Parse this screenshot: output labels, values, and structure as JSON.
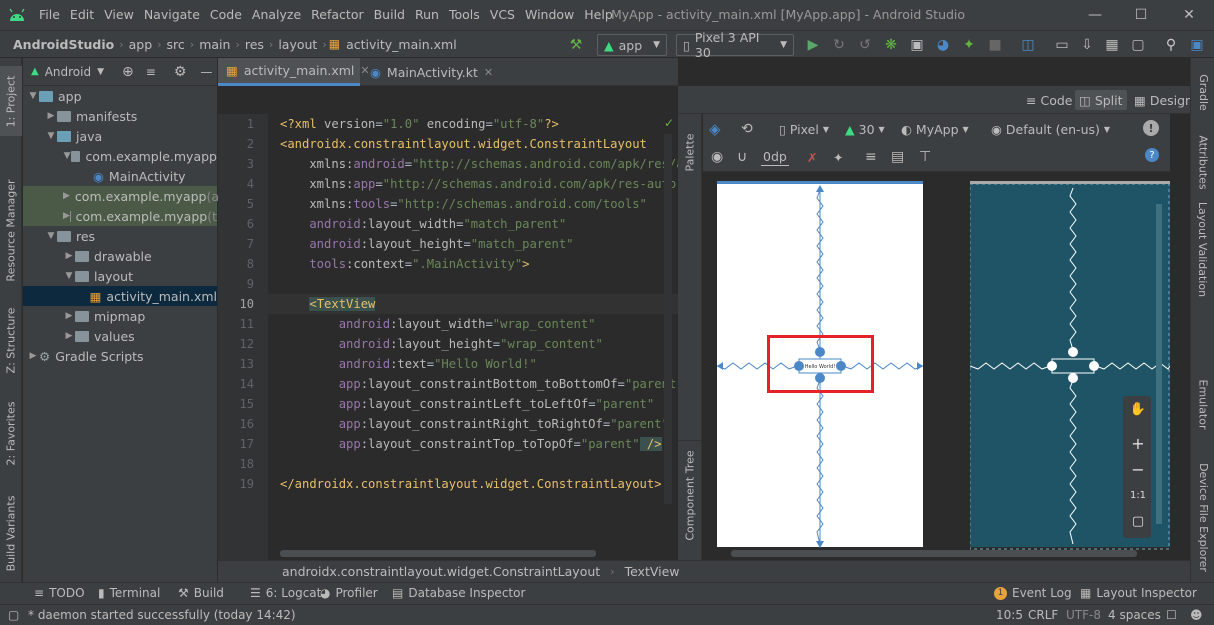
{
  "menubar": {
    "items": [
      "File",
      "Edit",
      "View",
      "Navigate",
      "Code",
      "Analyze",
      "Refactor",
      "Build",
      "Run",
      "Tools",
      "VCS",
      "Window",
      "Help"
    ],
    "window_title": "MyApp - activity_main.xml [MyApp.app] - Android Studio"
  },
  "navbar": {
    "breadcrumbs": [
      "AndroidStudio",
      "app",
      "src",
      "main",
      "res",
      "layout",
      "activity_main.xml"
    ],
    "run_config": "app",
    "device": "Pixel 3 API 30"
  },
  "project_panel": {
    "view_label": "Android",
    "tree": [
      {
        "label": "app",
        "kind": "root"
      },
      {
        "label": "manifests",
        "kind": "folder"
      },
      {
        "label": "java",
        "kind": "folder"
      },
      {
        "label": "com.example.myapp",
        "kind": "package"
      },
      {
        "label": "MainActivity",
        "kind": "class"
      },
      {
        "label": "com.example.myapp",
        "suffix": "(a",
        "kind": "package"
      },
      {
        "label": "com.example.myapp",
        "suffix": "(t",
        "kind": "package"
      },
      {
        "label": "res",
        "kind": "folder"
      },
      {
        "label": "drawable",
        "kind": "folder"
      },
      {
        "label": "layout",
        "kind": "folder"
      },
      {
        "label": "activity_main.xml",
        "kind": "file"
      },
      {
        "label": "mipmap",
        "kind": "folder"
      },
      {
        "label": "values",
        "kind": "folder"
      },
      {
        "label": "Gradle Scripts",
        "kind": "gradle"
      }
    ]
  },
  "side_tabs": {
    "left": [
      "1: Project",
      "Resource Manager",
      "Z: Structure",
      "2: Favorites",
      "Build Variants"
    ],
    "right": [
      "Gradle",
      "Attributes",
      "Layout Validation",
      "Emulator",
      "Device File Explorer"
    ]
  },
  "editor_tabs": [
    {
      "label": "activity_main.xml",
      "active": true
    },
    {
      "label": "MainActivity.kt",
      "active": false
    }
  ],
  "view_modes": [
    "Code",
    "Split",
    "Design"
  ],
  "editor": {
    "line_numbers": [
      "1",
      "2",
      "3",
      "4",
      "5",
      "6",
      "7",
      "8",
      "9",
      "10",
      "11",
      "12",
      "13",
      "14",
      "15",
      "16",
      "17",
      "18",
      "19"
    ],
    "lines": [
      [
        {
          "t": "<?xml ",
          "c": "pi"
        },
        {
          "t": "version",
          "c": "attr"
        },
        {
          "t": "=",
          "c": "p"
        },
        {
          "t": "\"1.0\"",
          "c": "val"
        },
        {
          "t": " encoding",
          "c": "attr"
        },
        {
          "t": "=",
          "c": "p"
        },
        {
          "t": "\"utf-8\"",
          "c": "val"
        },
        {
          "t": "?>",
          "c": "pi"
        }
      ],
      [
        {
          "t": "<androidx.constraintlayout.widget.ConstraintLayout",
          "c": "tag"
        }
      ],
      [
        {
          "t": "    xmlns:",
          "c": "attr"
        },
        {
          "t": "android",
          "c": "ns"
        },
        {
          "t": "=",
          "c": "p"
        },
        {
          "t": "\"http://schemas.android.com/apk/res/and",
          "c": "val"
        }
      ],
      [
        {
          "t": "    xmlns:",
          "c": "attr"
        },
        {
          "t": "app",
          "c": "ns"
        },
        {
          "t": "=",
          "c": "p"
        },
        {
          "t": "\"http://schemas.android.com/apk/res-auto\"",
          "c": "val"
        }
      ],
      [
        {
          "t": "    xmlns:",
          "c": "attr"
        },
        {
          "t": "tools",
          "c": "ns"
        },
        {
          "t": "=",
          "c": "p"
        },
        {
          "t": "\"http://schemas.android.com/tools\"",
          "c": "val"
        }
      ],
      [
        {
          "t": "    android",
          "c": "ns"
        },
        {
          "t": ":layout_width",
          "c": "attr"
        },
        {
          "t": "=",
          "c": "p"
        },
        {
          "t": "\"match_parent\"",
          "c": "val"
        }
      ],
      [
        {
          "t": "    android",
          "c": "ns"
        },
        {
          "t": ":layout_height",
          "c": "attr"
        },
        {
          "t": "=",
          "c": "p"
        },
        {
          "t": "\"match_parent\"",
          "c": "val"
        }
      ],
      [
        {
          "t": "    tools",
          "c": "ns"
        },
        {
          "t": ":context",
          "c": "attr"
        },
        {
          "t": "=",
          "c": "p"
        },
        {
          "t": "\".MainActivity\"",
          "c": "val"
        },
        {
          "t": ">",
          "c": "tag"
        }
      ],
      [],
      [
        {
          "t": "    ",
          "c": "p"
        },
        {
          "t": "<TextView",
          "c": "tagh"
        }
      ],
      [
        {
          "t": "        android",
          "c": "ns"
        },
        {
          "t": ":layout_width",
          "c": "attr"
        },
        {
          "t": "=",
          "c": "p"
        },
        {
          "t": "\"wrap_content\"",
          "c": "val"
        }
      ],
      [
        {
          "t": "        android",
          "c": "ns"
        },
        {
          "t": ":layout_height",
          "c": "attr"
        },
        {
          "t": "=",
          "c": "p"
        },
        {
          "t": "\"wrap_content\"",
          "c": "val"
        }
      ],
      [
        {
          "t": "        android",
          "c": "ns"
        },
        {
          "t": ":text",
          "c": "attr"
        },
        {
          "t": "=",
          "c": "p"
        },
        {
          "t": "\"Hello World!\"",
          "c": "val"
        }
      ],
      [
        {
          "t": "        app",
          "c": "ns"
        },
        {
          "t": ":layout_constraintBottom_toBottomOf",
          "c": "attr"
        },
        {
          "t": "=",
          "c": "p"
        },
        {
          "t": "\"parent\"",
          "c": "val"
        }
      ],
      [
        {
          "t": "        app",
          "c": "ns"
        },
        {
          "t": ":layout_constraintLeft_toLeftOf",
          "c": "attr"
        },
        {
          "t": "=",
          "c": "p"
        },
        {
          "t": "\"parent\"",
          "c": "val"
        }
      ],
      [
        {
          "t": "        app",
          "c": "ns"
        },
        {
          "t": ":layout_constraintRight_toRightOf",
          "c": "attr"
        },
        {
          "t": "=",
          "c": "p"
        },
        {
          "t": "\"parent\"",
          "c": "val"
        }
      ],
      [
        {
          "t": "        app",
          "c": "ns"
        },
        {
          "t": ":layout_constraintTop_toTopOf",
          "c": "attr"
        },
        {
          "t": "=",
          "c": "p"
        },
        {
          "t": "\"parent\"",
          "c": "val"
        },
        {
          "t": " />",
          "c": "tagh"
        }
      ],
      [],
      [
        {
          "t": "</androidx.constraintlayout.widget.ConstraintLayout>",
          "c": "tag"
        }
      ]
    ]
  },
  "design": {
    "palette_label": "Palette",
    "component_tree_label": "Component Tree",
    "device": "Pixel",
    "api": "30",
    "theme": "MyApp",
    "locale": "Default (en-us)",
    "margin": "0dp",
    "preview_text": "Hello World!"
  },
  "pathbar": [
    "androidx.constraintlayout.widget.ConstraintLayout",
    "TextView"
  ],
  "bottom_tools": {
    "left": [
      "TODO",
      "Terminal",
      "Build",
      "6: Logcat",
      "Profiler",
      "Database Inspector"
    ],
    "right": [
      "Event Log",
      "Layout Inspector"
    ]
  },
  "status": {
    "message": "* daemon started successfully (today 14:42)",
    "position": "10:5",
    "line_sep": "CRLF",
    "encoding": "UTF-8",
    "indent": "4 spaces"
  },
  "colors": {
    "accent": "#4a88c7",
    "highlight_box": "#e8202a",
    "blueprint": "#1e5466"
  }
}
